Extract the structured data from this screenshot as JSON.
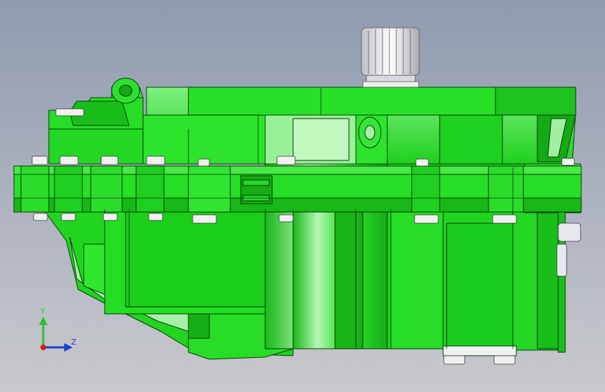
{
  "viewport": {
    "background_top": "#8f9bb1",
    "background_bottom": "#c8c9cc"
  },
  "model": {
    "body_color": "#22dd22",
    "edge_color": "#063806",
    "shade_color": "#12a912",
    "highlight_color": "#aef5ae",
    "fastener_color": "#f1f1f1",
    "shaft_color": "#e9e9ef"
  },
  "triad": {
    "y_label": "Y",
    "z_label": "Z",
    "y_color": "#2fbf2f",
    "z_color": "#1f3fd0",
    "x_color": "#d01f1f"
  }
}
